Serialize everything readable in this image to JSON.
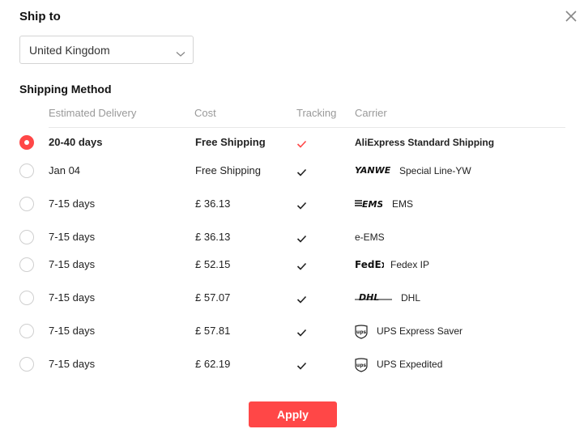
{
  "dialog": {
    "title": "Ship to",
    "close_icon": "close-icon"
  },
  "country_select": {
    "value": "United Kingdom",
    "icon": "chevron-down-icon"
  },
  "shipping": {
    "section_title": "Shipping Method",
    "columns": {
      "delivery": "Estimated Delivery",
      "cost": "Cost",
      "tracking": "Tracking",
      "carrier": "Carrier"
    },
    "rows": [
      {
        "delivery": "20-40 days",
        "cost": "Free Shipping",
        "tracking": true,
        "carrier": "AliExpress Standard Shipping",
        "logo": "",
        "selected": true
      },
      {
        "delivery": "Jan 04",
        "cost": "Free Shipping",
        "tracking": true,
        "carrier": "Special Line-YW",
        "logo": "YANWEN",
        "selected": false
      },
      {
        "delivery": "7-15 days",
        "cost": "£ 36.13",
        "tracking": true,
        "carrier": "EMS",
        "logo": "EMS",
        "selected": false
      },
      {
        "delivery": "7-15 days",
        "cost": "£ 36.13",
        "tracking": true,
        "carrier": "e-EMS",
        "logo": "",
        "selected": false
      },
      {
        "delivery": "7-15 days",
        "cost": "£ 52.15",
        "tracking": true,
        "carrier": "Fedex IP",
        "logo": "FedEx",
        "selected": false
      },
      {
        "delivery": "7-15 days",
        "cost": "£ 57.07",
        "tracking": true,
        "carrier": "DHL",
        "logo": "DHL",
        "selected": false
      },
      {
        "delivery": "7-15 days",
        "cost": "£ 57.81",
        "tracking": true,
        "carrier": "UPS Express Saver",
        "logo": "ups",
        "selected": false
      },
      {
        "delivery": "7-15 days",
        "cost": "£ 62.19",
        "tracking": true,
        "carrier": "UPS Expedited",
        "logo": "ups",
        "selected": false
      }
    ]
  },
  "apply_label": "Apply",
  "colors": {
    "accent": "#ff4747",
    "check": "#222222",
    "check_selected": "#ff4747"
  }
}
